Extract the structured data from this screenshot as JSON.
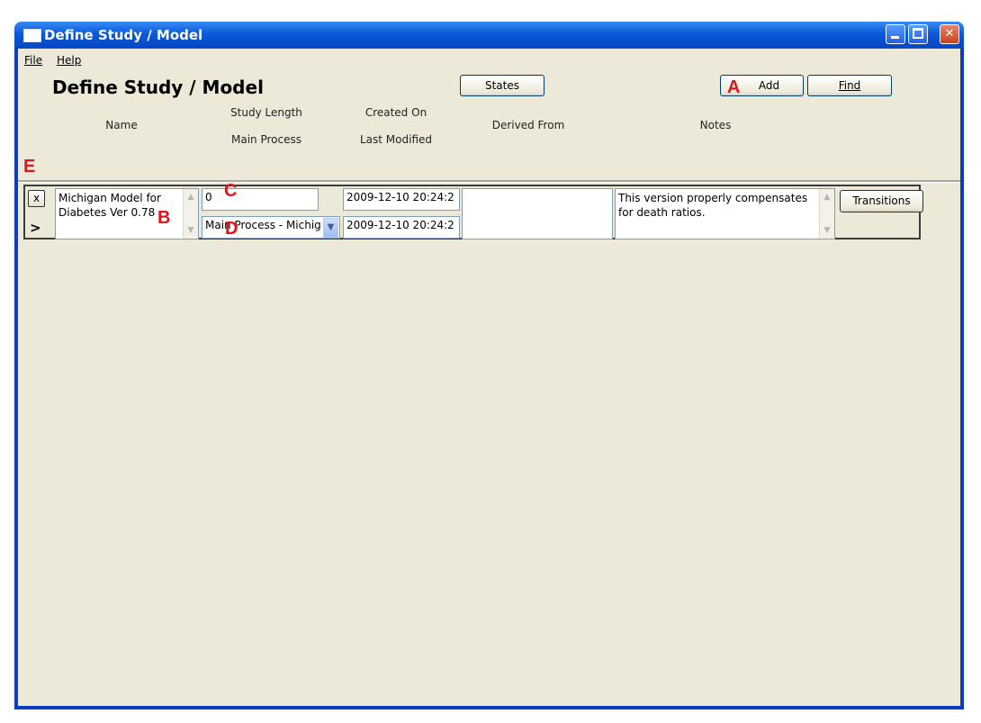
{
  "window": {
    "title": "Define Study / Model"
  },
  "menu": {
    "file": "File",
    "help": "Help"
  },
  "page": {
    "heading": "Define Study / Model"
  },
  "toolbar": {
    "states_label": "States",
    "add_label": "Add",
    "find_label": "Find"
  },
  "columns": {
    "name": "Name",
    "study_length": "Study Length",
    "main_process": "Main Process",
    "created_on": "Created On",
    "last_modified": "Last Modified",
    "derived_from": "Derived From",
    "notes": "Notes"
  },
  "markers": {
    "a": "A",
    "b": "B",
    "c": "C",
    "d": "D",
    "e": "E"
  },
  "record": {
    "delete_label": "x",
    "current_indicator": ">",
    "name": "Michigan Model for Diabetes Ver 0.78",
    "study_length": "0",
    "main_process": "Main Process - Michig",
    "created_on": "2009-12-10 20:24:2",
    "last_modified": "2009-12-10 20:24:2",
    "derived_from": "",
    "notes": "This version properly compensates for death ratios.",
    "transitions_label": "Transitions"
  }
}
